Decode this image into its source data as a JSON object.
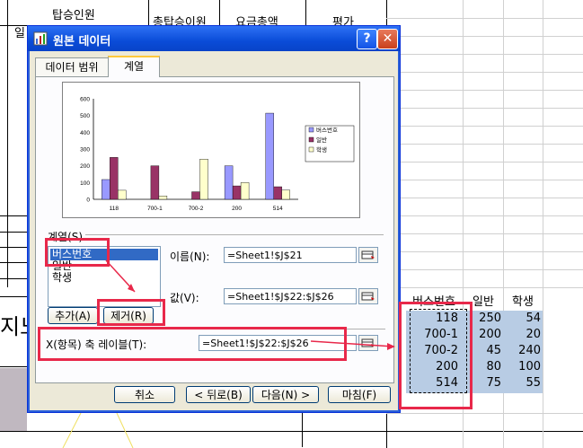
{
  "background": {
    "header_passengers": "탑승인원",
    "header_total": "총탑승이원",
    "header_fare": "요금총액",
    "header_eval": "평가",
    "row_prefix": "일",
    "big_char": "지노",
    "sheet_table": {
      "headers": [
        "버스번호",
        "일반",
        "학생"
      ],
      "rows": [
        [
          "118",
          "250",
          "54"
        ],
        [
          "700-1",
          "200",
          "20"
        ],
        [
          "700-2",
          "45",
          "240"
        ],
        [
          "200",
          "80",
          "100"
        ],
        [
          "514",
          "75",
          "55"
        ]
      ]
    }
  },
  "dialog": {
    "title": "원본 데이터",
    "help_label": "?",
    "close_label": "✕",
    "tabs": [
      "데이터 범위",
      "계열"
    ],
    "series_section_label": "계열(S)",
    "series_list": [
      "버스번호",
      "일반",
      "학생"
    ],
    "name_label": "이름(N):",
    "name_value": "=Sheet1!$J$21",
    "values_label": "값(V):",
    "values_value": "=Sheet1!$J$22:$J$26",
    "add_button": "추가(A)",
    "remove_button": "제거(R)",
    "xaxis_label": "X(항목) 축 레이블(T):",
    "xaxis_value": "=Sheet1!$J$22:$J$26",
    "footer_buttons": {
      "cancel": "취소",
      "back": "< 뒤로(B)",
      "next": "다음(N) >",
      "finish": "마침(F)"
    }
  },
  "chart_data": {
    "type": "bar",
    "categories": [
      "118",
      "700-1",
      "700-2",
      "200",
      "514"
    ],
    "series": [
      {
        "name": "버스번호",
        "values": [
          118,
          0,
          0,
          200,
          514
        ]
      },
      {
        "name": "일반",
        "values": [
          250,
          200,
          45,
          80,
          75
        ]
      },
      {
        "name": "학생",
        "values": [
          54,
          20,
          240,
          100,
          55
        ]
      }
    ],
    "ylim": [
      0,
      600
    ],
    "yticks": [
      "0",
      "100",
      "200",
      "300",
      "400",
      "500",
      "600"
    ],
    "legend_position": "right",
    "colors": [
      "#9999ff",
      "#993366",
      "#ffffcc"
    ]
  },
  "annotation_color": "#e8284a"
}
